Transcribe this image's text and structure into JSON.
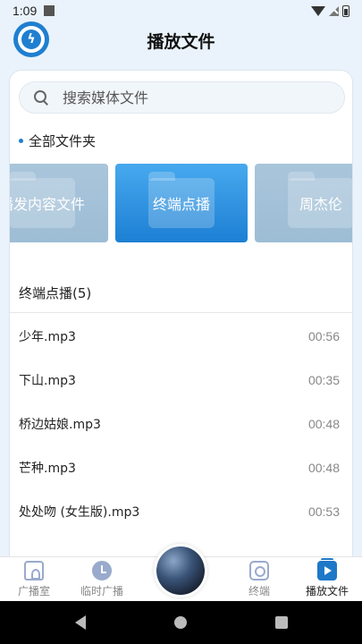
{
  "status_bar": {
    "time": "1:09"
  },
  "header": {
    "title": "播放文件",
    "logo_glyph": "ϟ"
  },
  "search": {
    "placeholder": "搜索媒体文件",
    "value": ""
  },
  "folders": {
    "heading": "全部文件夹",
    "items": [
      {
        "label": "播发内容文件",
        "active": false
      },
      {
        "label": "终端点播",
        "active": true
      },
      {
        "label": "周杰伦",
        "active": false
      }
    ]
  },
  "file_list": {
    "title": "终端点播(5)",
    "files": [
      {
        "name": "少年.mp3",
        "duration": "00:56"
      },
      {
        "name": "下山.mp3",
        "duration": "00:35"
      },
      {
        "name": "桥边姑娘.mp3",
        "duration": "00:48"
      },
      {
        "name": "芒种.mp3",
        "duration": "00:48"
      },
      {
        "name": "处处吻 (女生版).mp3",
        "duration": "00:53"
      }
    ]
  },
  "bottom_nav": {
    "items": [
      {
        "label": "广播室",
        "icon": "home-icon",
        "active": false
      },
      {
        "label": "临时广播",
        "icon": "clock-icon",
        "active": false
      },
      {
        "label": "终端",
        "icon": "camera-icon",
        "active": false
      },
      {
        "label": "播放文件",
        "icon": "play-file-icon",
        "active": true
      }
    ]
  },
  "colors": {
    "accent": "#1f7fd0",
    "active_tile": "#2a8ee0",
    "inactive_tile": "#a3c1d8"
  }
}
